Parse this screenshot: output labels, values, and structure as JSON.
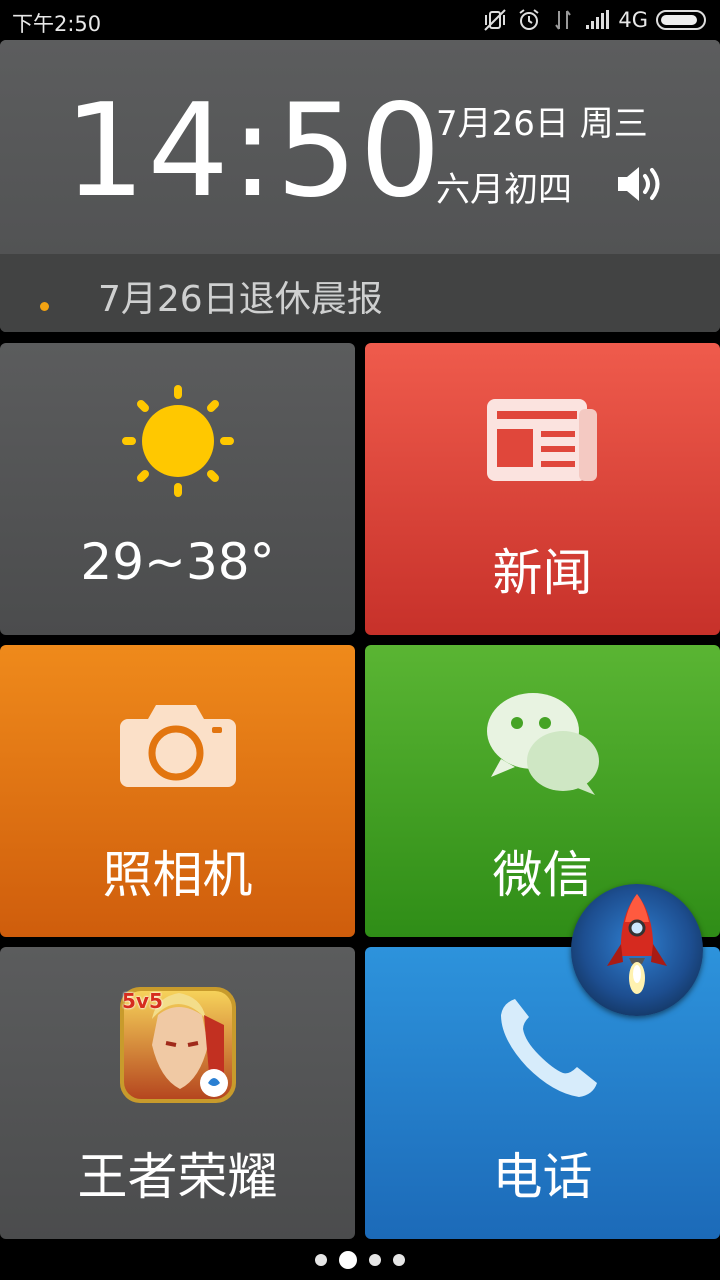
{
  "status_bar": {
    "time": "下午2:50",
    "network": "4G",
    "battery_level": 0.85
  },
  "clock": {
    "time": "14:50",
    "date": "7月26日 周三",
    "lunar": "六月初四"
  },
  "news_ticker": {
    "text": "7月26日退休晨报"
  },
  "tiles": {
    "weather": {
      "label": "29~38°"
    },
    "news": {
      "label": "新闻"
    },
    "camera": {
      "label": "照相机"
    },
    "wechat": {
      "label": "微信"
    },
    "game": {
      "label": "王者荣耀",
      "badge": "5v5"
    },
    "phone": {
      "label": "电话"
    }
  },
  "pager": {
    "count": 4,
    "active_index": 1
  },
  "colors": {
    "news_tile": "#e0473b",
    "camera_tile": "#e2750f",
    "wechat_tile": "#45a325",
    "phone_tile": "#257fcc",
    "gray_tile": "#545556",
    "sun": "#ffc800",
    "ticker_dot": "#f3a312"
  }
}
